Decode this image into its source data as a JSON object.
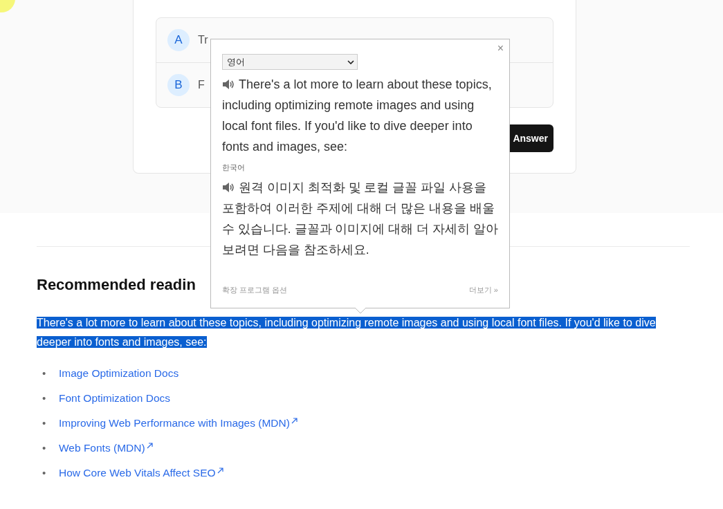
{
  "quiz": {
    "options": [
      {
        "letter": "A",
        "text": "Tr"
      },
      {
        "letter": "B",
        "text": "F"
      }
    ],
    "submit_button": "Answer"
  },
  "article": {
    "heading": "Recommended readin",
    "paragraph": "There's a lot more to learn about these topics, including optimizing remote images and using local font files. If you'd like to dive deeper into fonts and images, see:",
    "paragraph_selected": true,
    "links": [
      {
        "bullet": "•",
        "text": "Image Optimization Docs",
        "external": false
      },
      {
        "bullet": "•",
        "text": "Font Optimization Docs",
        "external": false
      },
      {
        "bullet": "•",
        "text": "Improving Web Performance with Images (MDN)",
        "external": true
      },
      {
        "bullet": "•",
        "text": "Web Fonts (MDN)",
        "external": true
      },
      {
        "bullet": "•",
        "text": "How Core Web Vitals Affect SEO",
        "external": true
      }
    ]
  },
  "translate_popup": {
    "close": "×",
    "source_language": "영어",
    "source_text": "There's a lot more to learn about these topics, including optimizing remote images and using local font files. If you'd like to dive deeper into fonts and images, see:",
    "target_language": "한국어",
    "target_text": "원격 이미지 최적화 및 로컬 글꼴 파일 사용을 포함하여 이러한 주제에 대해 더 많은 내용을 배울 수 있습니다. 글꼴과 이미지에 대해 더 자세히 알아보려면 다음을 참조하세요.",
    "options_link": "확장 프로그램 옵션",
    "more_link": "더보기 »"
  }
}
